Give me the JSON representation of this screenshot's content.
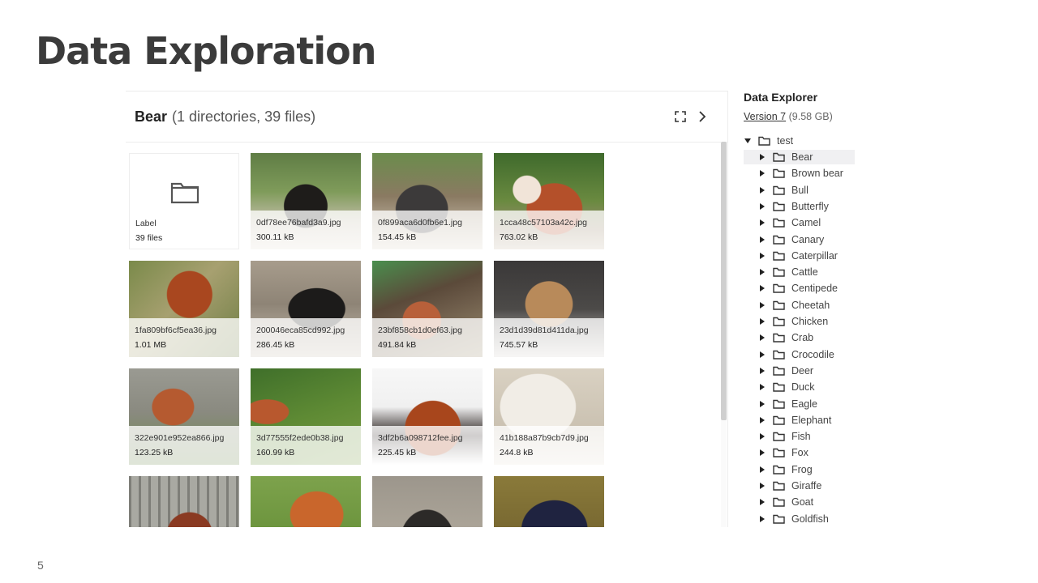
{
  "slide": {
    "title": "Data Exploration",
    "number": "5"
  },
  "browser": {
    "folder_name": "Bear",
    "folder_meta": "(1 directories, 39 files)",
    "folder_tile": {
      "label": "Label",
      "count": "39 files"
    },
    "files": [
      {
        "name": "0df78ee76bafd3a9.jpg",
        "size": "300.11 kB"
      },
      {
        "name": "0f899aca6d0fb6e1.jpg",
        "size": "154.45 kB"
      },
      {
        "name": "1cca48c57103a42c.jpg",
        "size": "763.02 kB"
      },
      {
        "name": "1fa809bf6cf5ea36.jpg",
        "size": "1.01 MB"
      },
      {
        "name": "200046eca85cd992.jpg",
        "size": "286.45 kB"
      },
      {
        "name": "23bf858cb1d0ef63.jpg",
        "size": "491.84 kB"
      },
      {
        "name": "23d1d39d81d411da.jpg",
        "size": "745.57 kB"
      },
      {
        "name": "322e901e952ea866.jpg",
        "size": "123.25 kB"
      },
      {
        "name": "3d77555f2ede0b38.jpg",
        "size": "160.99 kB"
      },
      {
        "name": "3df2b6a098712fee.jpg",
        "size": "225.45 kB"
      },
      {
        "name": "41b188a87b9cb7d9.jpg",
        "size": "244.8 kB"
      },
      {
        "name": "",
        "size": ""
      },
      {
        "name": "",
        "size": ""
      },
      {
        "name": "",
        "size": ""
      },
      {
        "name": "",
        "size": ""
      }
    ]
  },
  "explorer": {
    "title": "Data Explorer",
    "version": "Version 7",
    "size": "(9.58 GB)",
    "root": "test",
    "selected": "Bear",
    "items": [
      "Bear",
      "Brown bear",
      "Bull",
      "Butterfly",
      "Camel",
      "Canary",
      "Caterpillar",
      "Cattle",
      "Centipede",
      "Cheetah",
      "Chicken",
      "Crab",
      "Crocodile",
      "Deer",
      "Duck",
      "Eagle",
      "Elephant",
      "Fish",
      "Fox",
      "Frog",
      "Giraffe",
      "Goat",
      "Goldfish"
    ]
  }
}
